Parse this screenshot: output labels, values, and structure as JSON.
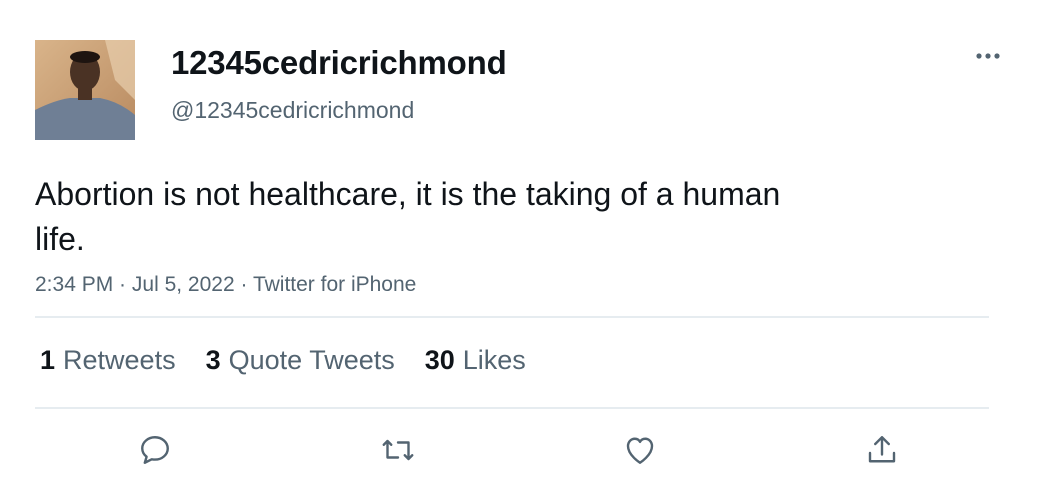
{
  "tweet": {
    "author": {
      "display_name": "12345cedricrichmond",
      "handle": "@12345cedricrichmond"
    },
    "text": "Abortion is not healthcare, it is the taking of a human life.",
    "time": "2:34 PM",
    "date": "Jul 5, 2022",
    "source": "Twitter for iPhone",
    "separator": " · "
  },
  "stats": {
    "retweets_count": "1",
    "retweets_label": "Retweets",
    "quotes_count": "3",
    "quotes_label": "Quote Tweets",
    "likes_count": "30",
    "likes_label": "Likes"
  },
  "icons": {
    "more": "more-horizontal-icon",
    "reply": "reply-icon",
    "retweet": "retweet-icon",
    "like": "heart-icon",
    "share": "share-icon"
  },
  "colors": {
    "text_primary": "#0f1419",
    "text_secondary": "#536471",
    "divider": "#e6ecf0"
  }
}
